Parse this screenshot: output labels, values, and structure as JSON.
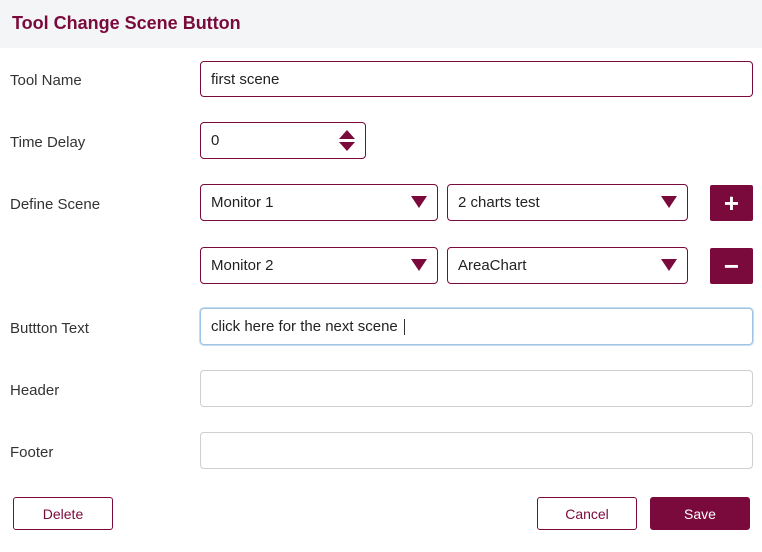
{
  "dialog": {
    "title": "Tool Change Scene Button"
  },
  "form": {
    "tool_name": {
      "label": "Tool Name",
      "value": "first scene"
    },
    "time_delay": {
      "label": "Time Delay",
      "value": "0"
    },
    "define_scene": {
      "label": "Define Scene",
      "rows": [
        {
          "monitor": "Monitor 1",
          "chart": "2 charts test",
          "action_icon": "plus-icon",
          "action_symbol": "+"
        },
        {
          "monitor": "Monitor 2",
          "chart": "AreaChart",
          "action_icon": "minus-icon",
          "action_symbol": "−"
        }
      ]
    },
    "button_text": {
      "label": "Buttton Text",
      "value": "click here for the next scene"
    },
    "header": {
      "label": "Header",
      "value": ""
    },
    "footer": {
      "label": "Footer",
      "value": ""
    }
  },
  "actions": {
    "delete": "Delete",
    "cancel": "Cancel",
    "save": "Save"
  },
  "colors": {
    "accent": "#7a0a3c",
    "header_bg": "#f4f5f7",
    "focus_border": "#9fc4e6"
  }
}
